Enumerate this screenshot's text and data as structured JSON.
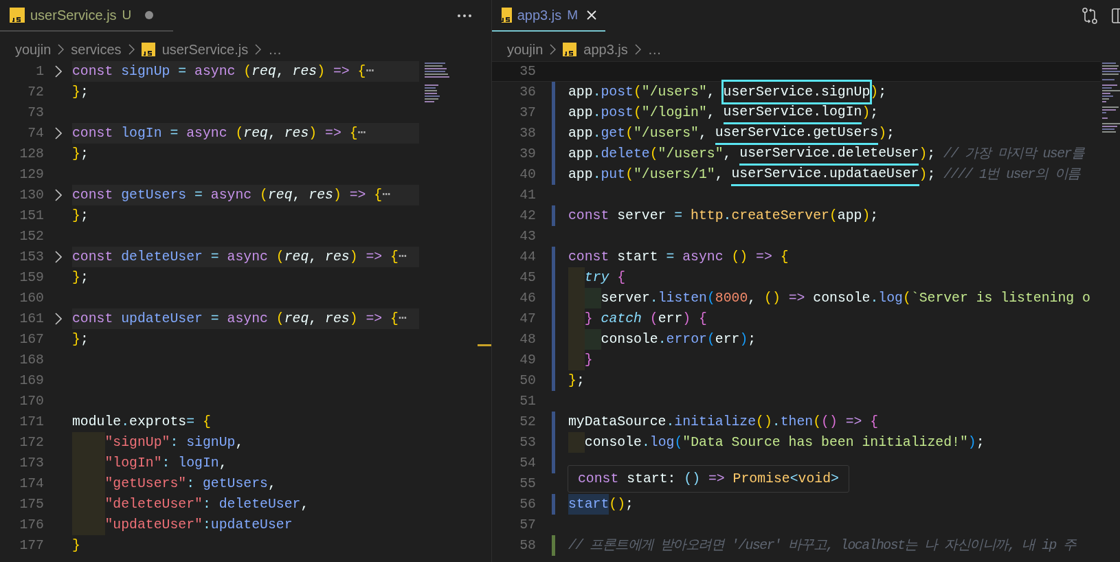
{
  "panes": [
    {
      "tab": {
        "label": "userService.js",
        "status": "U",
        "color": "#a3ad74",
        "dirty": true,
        "focused": false
      },
      "breadcrumbs": [
        {
          "kind": "folder",
          "text": "youjin"
        },
        {
          "kind": "folder",
          "text": "services"
        },
        {
          "kind": "file",
          "text": "userService.js"
        },
        {
          "kind": "more",
          "text": "…"
        }
      ],
      "lines": [
        {
          "n": "1",
          "folded": true,
          "tokens": [
            {
              "text": "const ",
              "kind": "kw"
            },
            {
              "text": "signUp",
              "kind": "fn"
            },
            {
              "text": " = ",
              "kind": "op"
            },
            {
              "text": "async ",
              "kind": "kw"
            },
            {
              "text": "(",
              "kind": "b1"
            },
            {
              "text": "req",
              "kind": "param"
            },
            {
              "text": ", ",
              "kind": "plain"
            },
            {
              "text": "res",
              "kind": "param"
            },
            {
              "text": ")",
              "kind": "b1"
            },
            {
              "text": " => ",
              "kind": "kw"
            },
            {
              "text": "{",
              "kind": "b1"
            },
            {
              "text": "⋯",
              "kind": "fold"
            }
          ]
        },
        {
          "n": "72",
          "folded": false,
          "tokens": [
            {
              "text": "}",
              "kind": "b1"
            },
            {
              "text": ";",
              "kind": "plain"
            }
          ]
        },
        {
          "n": "73",
          "folded": false
        },
        {
          "n": "74",
          "folded": true,
          "tokens": [
            {
              "text": "const ",
              "kind": "kw"
            },
            {
              "text": "logIn",
              "kind": "fn"
            },
            {
              "text": " = ",
              "kind": "op"
            },
            {
              "text": "async ",
              "kind": "kw"
            },
            {
              "text": "(",
              "kind": "b1"
            },
            {
              "text": "req",
              "kind": "param"
            },
            {
              "text": ", ",
              "kind": "plain"
            },
            {
              "text": "res",
              "kind": "param"
            },
            {
              "text": ")",
              "kind": "b1"
            },
            {
              "text": " => ",
              "kind": "kw"
            },
            {
              "text": "{",
              "kind": "b1"
            },
            {
              "text": "⋯",
              "kind": "fold"
            }
          ]
        },
        {
          "n": "128",
          "folded": false,
          "tokens": [
            {
              "text": "}",
              "kind": "b1"
            },
            {
              "text": ";",
              "kind": "plain"
            }
          ]
        },
        {
          "n": "129",
          "folded": false
        },
        {
          "n": "130",
          "folded": true,
          "tokens": [
            {
              "text": "const ",
              "kind": "kw"
            },
            {
              "text": "getUsers",
              "kind": "fn"
            },
            {
              "text": " = ",
              "kind": "op"
            },
            {
              "text": "async ",
              "kind": "kw"
            },
            {
              "text": "(",
              "kind": "b1"
            },
            {
              "text": "req",
              "kind": "param"
            },
            {
              "text": ", ",
              "kind": "plain"
            },
            {
              "text": "res",
              "kind": "param"
            },
            {
              "text": ")",
              "kind": "b1"
            },
            {
              "text": " => ",
              "kind": "kw"
            },
            {
              "text": "{",
              "kind": "b1"
            },
            {
              "text": "⋯",
              "kind": "fold"
            }
          ]
        },
        {
          "n": "151",
          "folded": false,
          "tokens": [
            {
              "text": "}",
              "kind": "b1"
            },
            {
              "text": ";",
              "kind": "plain"
            }
          ]
        },
        {
          "n": "152",
          "folded": false
        },
        {
          "n": "153",
          "folded": true,
          "tokens": [
            {
              "text": "const ",
              "kind": "kw"
            },
            {
              "text": "deleteUser",
              "kind": "fn"
            },
            {
              "text": " = ",
              "kind": "op"
            },
            {
              "text": "async ",
              "kind": "kw"
            },
            {
              "text": "(",
              "kind": "b1"
            },
            {
              "text": "req",
              "kind": "param"
            },
            {
              "text": ", ",
              "kind": "plain"
            },
            {
              "text": "res",
              "kind": "param"
            },
            {
              "text": ")",
              "kind": "b1"
            },
            {
              "text": " => ",
              "kind": "kw"
            },
            {
              "text": "{",
              "kind": "b1"
            },
            {
              "text": "⋯",
              "kind": "fold"
            }
          ]
        },
        {
          "n": "159",
          "folded": false,
          "tokens": [
            {
              "text": "}",
              "kind": "b1"
            },
            {
              "text": ";",
              "kind": "plain"
            }
          ]
        },
        {
          "n": "160",
          "folded": false
        },
        {
          "n": "161",
          "folded": true,
          "tokens": [
            {
              "text": "const ",
              "kind": "kw"
            },
            {
              "text": "updateUser",
              "kind": "fn"
            },
            {
              "text": " = ",
              "kind": "op"
            },
            {
              "text": "async ",
              "kind": "kw"
            },
            {
              "text": "(",
              "kind": "b1"
            },
            {
              "text": "req",
              "kind": "param"
            },
            {
              "text": ", ",
              "kind": "plain"
            },
            {
              "text": "res",
              "kind": "param"
            },
            {
              "text": ")",
              "kind": "b1"
            },
            {
              "text": " => ",
              "kind": "kw"
            },
            {
              "text": "{",
              "kind": "b1"
            },
            {
              "text": "⋯",
              "kind": "fold"
            }
          ]
        },
        {
          "n": "167",
          "folded": false,
          "tokens": [
            {
              "text": "}",
              "kind": "b1"
            },
            {
              "text": ";",
              "kind": "plain"
            }
          ]
        },
        {
          "n": "168",
          "folded": false
        },
        {
          "n": "169",
          "folded": false
        },
        {
          "n": "170",
          "folded": false
        },
        {
          "n": "171",
          "folded": false,
          "tokens": [
            {
              "text": "module",
              "kind": "plain"
            },
            {
              "text": ".",
              "kind": "op"
            },
            {
              "text": "exprots",
              "kind": "plain"
            },
            {
              "text": "= ",
              "kind": "op"
            },
            {
              "text": "{",
              "kind": "b1"
            }
          ]
        },
        {
          "n": "172",
          "folded": false,
          "indent_guide": true,
          "tokens": [
            {
              "text": "\"signUp\"",
              "kind": "key"
            },
            {
              "text": ": ",
              "kind": "op"
            },
            {
              "text": "signUp",
              "kind": "fn"
            },
            {
              "text": ",",
              "kind": "plain"
            }
          ]
        },
        {
          "n": "173",
          "folded": false,
          "indent_guide": true,
          "tokens": [
            {
              "text": "\"logIn\"",
              "kind": "key"
            },
            {
              "text": ": ",
              "kind": "op"
            },
            {
              "text": "logIn",
              "kind": "fn"
            },
            {
              "text": ",",
              "kind": "plain"
            }
          ]
        },
        {
          "n": "174",
          "folded": false,
          "indent_guide": true,
          "tokens": [
            {
              "text": "\"getUsers\"",
              "kind": "key"
            },
            {
              "text": ": ",
              "kind": "op"
            },
            {
              "text": "getUsers",
              "kind": "fn"
            },
            {
              "text": ",",
              "kind": "plain"
            }
          ]
        },
        {
          "n": "175",
          "folded": false,
          "indent_guide": true,
          "tokens": [
            {
              "text": "\"deleteUser\"",
              "kind": "key"
            },
            {
              "text": ": ",
              "kind": "op"
            },
            {
              "text": "deleteUser",
              "kind": "fn"
            },
            {
              "text": ",",
              "kind": "plain"
            }
          ]
        },
        {
          "n": "176",
          "folded": false,
          "indent_guide": true,
          "tokens": [
            {
              "text": "\"updateUser\"",
              "kind": "key"
            },
            {
              "text": ":",
              "kind": "op"
            },
            {
              "text": "updateUser",
              "kind": "fn"
            }
          ]
        },
        {
          "n": "177",
          "folded": false,
          "tokens": [
            {
              "text": "}",
              "kind": "b1"
            }
          ]
        }
      ]
    },
    {
      "tab": {
        "label": "app3.js",
        "status": "M",
        "color": "#7a8fcf",
        "dirty": false,
        "focused": true
      },
      "breadcrumbs": [
        {
          "kind": "folder",
          "text": "youjin"
        },
        {
          "kind": "file",
          "text": "app3.js"
        },
        {
          "kind": "more",
          "text": "…"
        }
      ],
      "lines": [
        {
          "n": "35",
          "current": true
        },
        {
          "n": "36",
          "modified": true,
          "tokens": [
            {
              "text": "app",
              "kind": "plain"
            },
            {
              "text": ".",
              "kind": "op"
            },
            {
              "text": "post",
              "kind": "fn"
            },
            {
              "text": "(",
              "kind": "b1"
            },
            {
              "text": "\"/users\"",
              "kind": "str"
            },
            {
              "text": ", ",
              "kind": "plain"
            },
            {
              "text": "userService.signUp",
              "kind": "plain",
              "boxed": true
            },
            {
              "text": ")",
              "kind": "b1"
            },
            {
              "text": ";",
              "kind": "plain"
            }
          ]
        },
        {
          "n": "37",
          "modified": true,
          "tokens": [
            {
              "text": "app",
              "kind": "plain"
            },
            {
              "text": ".",
              "kind": "op"
            },
            {
              "text": "post",
              "kind": "fn"
            },
            {
              "text": "(",
              "kind": "b1"
            },
            {
              "text": "\"/login\"",
              "kind": "str"
            },
            {
              "text": ", ",
              "kind": "plain"
            },
            {
              "text": "userService.logIn",
              "kind": "plain",
              "underlined": true
            },
            {
              "text": ")",
              "kind": "b1"
            },
            {
              "text": ";",
              "kind": "plain"
            }
          ]
        },
        {
          "n": "38",
          "modified": true,
          "tokens": [
            {
              "text": "app",
              "kind": "plain"
            },
            {
              "text": ".",
              "kind": "op"
            },
            {
              "text": "get",
              "kind": "fn"
            },
            {
              "text": "(",
              "kind": "b1"
            },
            {
              "text": "\"/users\"",
              "kind": "str"
            },
            {
              "text": ", ",
              "kind": "plain"
            },
            {
              "text": "userService.getUsers",
              "kind": "plain",
              "underlined": true
            },
            {
              "text": ")",
              "kind": "b1"
            },
            {
              "text": ";",
              "kind": "plain"
            }
          ]
        },
        {
          "n": "39",
          "modified": true,
          "tokens": [
            {
              "text": "app",
              "kind": "plain"
            },
            {
              "text": ".",
              "kind": "op"
            },
            {
              "text": "delete",
              "kind": "fn"
            },
            {
              "text": "(",
              "kind": "b1"
            },
            {
              "text": "\"/users\"",
              "kind": "str"
            },
            {
              "text": ", ",
              "kind": "plain"
            },
            {
              "text": "userService.deleteUser",
              "kind": "plain",
              "underlined": true
            },
            {
              "text": ")",
              "kind": "b1"
            },
            {
              "text": "; ",
              "kind": "plain"
            },
            {
              "text": "// 가장 마지막 user를",
              "kind": "cmt"
            }
          ]
        },
        {
          "n": "40",
          "modified": true,
          "tokens": [
            {
              "text": "app",
              "kind": "plain"
            },
            {
              "text": ".",
              "kind": "op"
            },
            {
              "text": "put",
              "kind": "fn"
            },
            {
              "text": "(",
              "kind": "b1"
            },
            {
              "text": "\"/users/1\"",
              "kind": "str"
            },
            {
              "text": ", ",
              "kind": "plain"
            },
            {
              "text": "userService.updataeUser",
              "kind": "plain",
              "underlined": true
            },
            {
              "text": ")",
              "kind": "b1"
            },
            {
              "text": "; ",
              "kind": "plain"
            },
            {
              "text": "//// 1번 user의 이름",
              "kind": "cmt"
            }
          ]
        },
        {
          "n": "41"
        },
        {
          "n": "42",
          "modified": true,
          "tokens": [
            {
              "text": "const ",
              "kind": "kw"
            },
            {
              "text": "server",
              "kind": "plain"
            },
            {
              "text": " = ",
              "kind": "op"
            },
            {
              "text": "http",
              "kind": "type"
            },
            {
              "text": ".",
              "kind": "op"
            },
            {
              "text": "createServer",
              "kind": "type"
            },
            {
              "text": "(",
              "kind": "b1"
            },
            {
              "text": "app",
              "kind": "plain"
            },
            {
              "text": ")",
              "kind": "b1"
            },
            {
              "text": ";",
              "kind": "plain"
            }
          ]
        },
        {
          "n": "43"
        },
        {
          "n": "44",
          "modified": true,
          "tokens": [
            {
              "text": "const ",
              "kind": "kw"
            },
            {
              "text": "start",
              "kind": "plain"
            },
            {
              "text": " = ",
              "kind": "op"
            },
            {
              "text": "async ",
              "kind": "kw"
            },
            {
              "text": "()",
              "kind": "b1"
            },
            {
              "text": " => ",
              "kind": "kw"
            },
            {
              "text": "{",
              "kind": "b1"
            }
          ]
        },
        {
          "n": "45",
          "modified": true,
          "indent_guide": true,
          "tokens": [
            {
              "text": "try",
              "kind": "kwi"
            },
            {
              "text": " {",
              "kind": "b2"
            }
          ]
        },
        {
          "n": "46",
          "modified": true,
          "indent_guide": true,
          "nested_guide": true,
          "tokens": [
            {
              "text": "server",
              "kind": "plain"
            },
            {
              "text": ".",
              "kind": "op"
            },
            {
              "text": "listen",
              "kind": "fn"
            },
            {
              "text": "(",
              "kind": "b3"
            },
            {
              "text": "8000",
              "kind": "num"
            },
            {
              "text": ", ",
              "kind": "plain"
            },
            {
              "text": "()",
              "kind": "b1"
            },
            {
              "text": " => ",
              "kind": "kw"
            },
            {
              "text": "console",
              "kind": "plain"
            },
            {
              "text": ".",
              "kind": "op"
            },
            {
              "text": "log",
              "kind": "fn"
            },
            {
              "text": "(",
              "kind": "b1"
            },
            {
              "text": "`Server is listening o",
              "kind": "str"
            }
          ]
        },
        {
          "n": "47",
          "modified": true,
          "indent_guide": true,
          "tokens": [
            {
              "text": "} ",
              "kind": "b2"
            },
            {
              "text": "catch ",
              "kind": "kwi"
            },
            {
              "text": "(",
              "kind": "b2"
            },
            {
              "text": "err",
              "kind": "plain"
            },
            {
              "text": ") {",
              "kind": "b2"
            }
          ]
        },
        {
          "n": "48",
          "modified": true,
          "indent_guide": true,
          "nested_guide": true,
          "tokens": [
            {
              "text": "console",
              "kind": "plain"
            },
            {
              "text": ".",
              "kind": "op"
            },
            {
              "text": "error",
              "kind": "fn"
            },
            {
              "text": "(",
              "kind": "b3"
            },
            {
              "text": "err",
              "kind": "plain"
            },
            {
              "text": ")",
              "kind": "b3"
            },
            {
              "text": ";",
              "kind": "plain"
            }
          ]
        },
        {
          "n": "49",
          "modified": true,
          "indent_guide": true,
          "tokens": [
            {
              "text": "}",
              "kind": "b2"
            }
          ]
        },
        {
          "n": "50",
          "modified": true,
          "tokens": [
            {
              "text": "}",
              "kind": "b1"
            },
            {
              "text": ";",
              "kind": "plain"
            }
          ]
        },
        {
          "n": "51"
        },
        {
          "n": "52",
          "modified": true,
          "tokens": [
            {
              "text": "myDataSource",
              "kind": "plain"
            },
            {
              "text": ".",
              "kind": "op"
            },
            {
              "text": "initialize",
              "kind": "fn"
            },
            {
              "text": "()",
              "kind": "b1"
            },
            {
              "text": ".",
              "kind": "op"
            },
            {
              "text": "then",
              "kind": "fn"
            },
            {
              "text": "(",
              "kind": "b1"
            },
            {
              "text": "()",
              "kind": "b2"
            },
            {
              "text": " => ",
              "kind": "kw"
            },
            {
              "text": "{",
              "kind": "b2"
            }
          ]
        },
        {
          "n": "53",
          "modified": true,
          "indent_guide": true,
          "tokens": [
            {
              "text": "console",
              "kind": "plain"
            },
            {
              "text": ".",
              "kind": "op"
            },
            {
              "text": "log",
              "kind": "fn"
            },
            {
              "text": "(",
              "kind": "b3"
            },
            {
              "text": "\"Data Source has been initialized!\"",
              "kind": "str"
            },
            {
              "text": ")",
              "kind": "b3"
            },
            {
              "text": ";",
              "kind": "plain"
            }
          ]
        },
        {
          "n": "54",
          "modified": true
        },
        {
          "n": "55"
        },
        {
          "n": "56",
          "modified": true,
          "tokens": [
            {
              "text": "start",
              "kind": "hl"
            },
            {
              "text": "()",
              "kind": "b1"
            },
            {
              "text": ";",
              "kind": "plain"
            }
          ]
        },
        {
          "n": "57"
        },
        {
          "n": "58",
          "added": true,
          "tokens": [
            {
              "text": "// 프론트에게 받아오려면 '/user' 바꾸고, localhost는 나 자신이니까, 내 ip 주",
              "kind": "cmt"
            }
          ]
        }
      ],
      "hover": {
        "tokens": [
          {
            "text": "const ",
            "kind": "kw"
          },
          {
            "text": "start",
            "kind": "plain"
          },
          {
            "text": ": ",
            "kind": "plain"
          },
          {
            "text": "()",
            "kind": "op"
          },
          {
            "text": " => ",
            "kind": "kw"
          },
          {
            "text": "Promise",
            "kind": "type"
          },
          {
            "text": "<",
            "kind": "op"
          },
          {
            "text": "void",
            "kind": "type"
          },
          {
            "text": ">",
            "kind": "op"
          }
        ]
      }
    }
  ]
}
